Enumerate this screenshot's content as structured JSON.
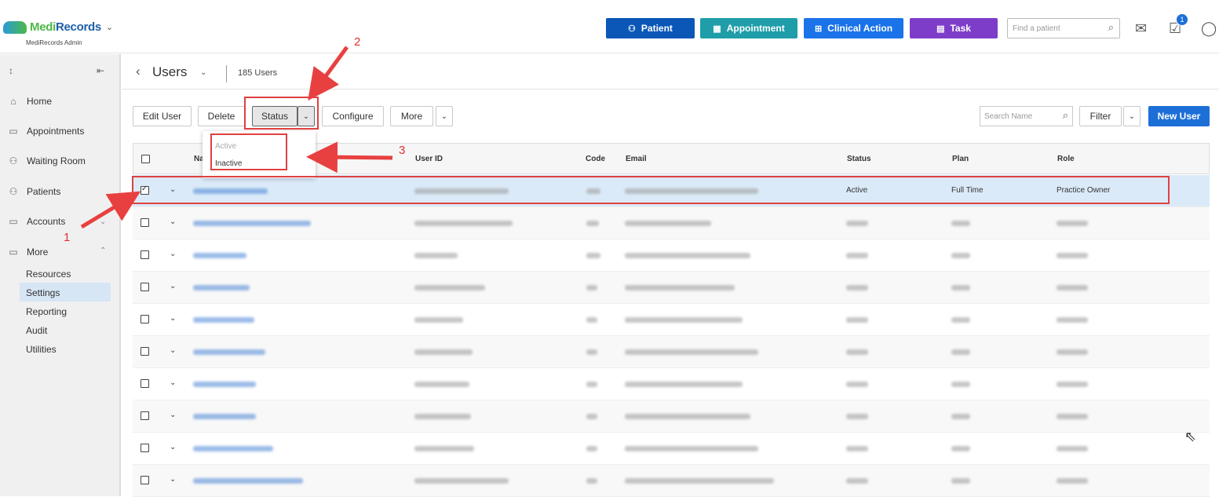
{
  "app": {
    "brand_part1": "Medi",
    "brand_part2": "Records",
    "subtitle": "MediRecords Admin"
  },
  "header": {
    "buttons": [
      {
        "label": "Patient",
        "color": "#0a57b8"
      },
      {
        "label": "Appointment",
        "color": "#1f9eaa"
      },
      {
        "label": "Clinical Action",
        "color": "#1a73e8"
      },
      {
        "label": "Task",
        "color": "#7e3dc9"
      }
    ],
    "find_placeholder": "Find a patient",
    "notification_count": "1"
  },
  "sidebar": {
    "nav": [
      "Home",
      "Appointments",
      "Waiting Room",
      "Patients",
      "Accounts",
      "More"
    ],
    "sub": [
      "Resources",
      "Settings",
      "Reporting",
      "Audit",
      "Utilities"
    ],
    "active_sub": "Settings"
  },
  "page": {
    "title": "Users",
    "count": "185 Users"
  },
  "toolbar": {
    "edit": "Edit User",
    "delete": "Delete",
    "status": "Status",
    "configure": "Configure",
    "more": "More",
    "search_placeholder": "Search Name",
    "filter": "Filter",
    "new_user": "New User"
  },
  "status_menu": {
    "items": [
      "Active",
      "Inactive"
    ]
  },
  "table": {
    "columns": [
      "Na",
      "User ID",
      "Code",
      "Email",
      "Status",
      "Plan",
      "Role"
    ],
    "selected_row": {
      "status": "Active",
      "plan": "Full Time",
      "role": "Practice Owner"
    }
  },
  "annotations": [
    "1",
    "2",
    "3"
  ]
}
